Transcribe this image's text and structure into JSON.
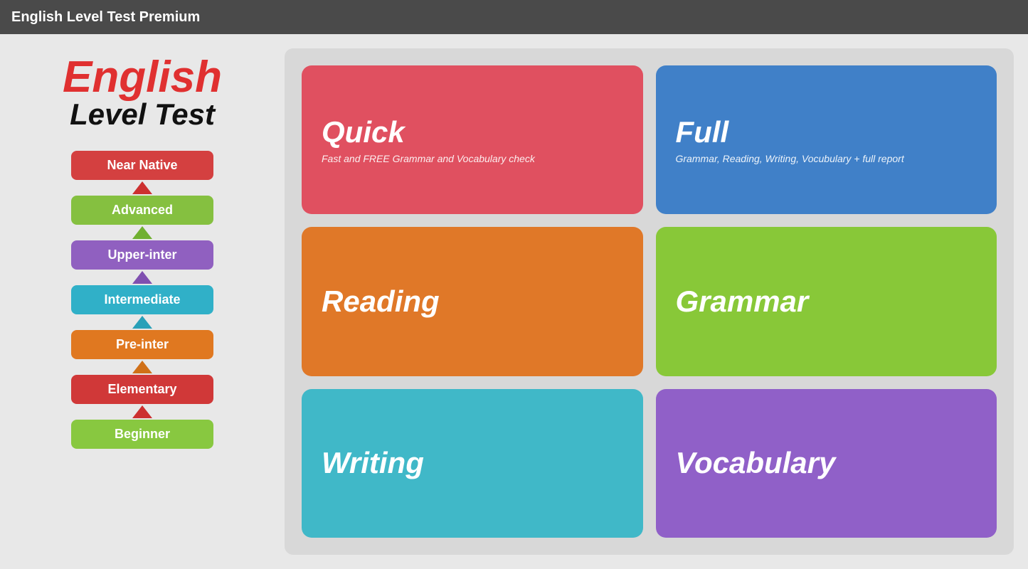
{
  "titleBar": {
    "label": "English Level Test Premium"
  },
  "logo": {
    "english": "English",
    "levelTest": "Level Test"
  },
  "levels": [
    {
      "id": "near-native",
      "label": "Near Native",
      "class": "level-near-native"
    },
    {
      "id": "advanced",
      "label": "Advanced",
      "class": "level-advanced"
    },
    {
      "id": "upper-inter",
      "label": "Upper-inter",
      "class": "level-upper-inter"
    },
    {
      "id": "intermediate",
      "label": "Intermediate",
      "class": "level-intermediate"
    },
    {
      "id": "pre-inter",
      "label": "Pre-inter",
      "class": "level-pre-inter"
    },
    {
      "id": "elementary",
      "label": "Elementary",
      "class": "level-elementary"
    },
    {
      "id": "beginner",
      "label": "Beginner",
      "class": "level-beginner"
    }
  ],
  "cards": [
    {
      "id": "quick",
      "title": "Quick",
      "subtitle": "Fast and FREE Grammar and Vocabulary check",
      "class": "card-quick"
    },
    {
      "id": "full",
      "title": "Full",
      "subtitle": "Grammar, Reading, Writing, Vocubulary + full report",
      "class": "card-full"
    },
    {
      "id": "reading",
      "title": "Reading",
      "subtitle": "",
      "class": "card-reading"
    },
    {
      "id": "grammar",
      "title": "Grammar",
      "subtitle": "",
      "class": "card-grammar"
    },
    {
      "id": "writing",
      "title": "Writing",
      "subtitle": "",
      "class": "card-writing"
    },
    {
      "id": "vocabulary",
      "title": "Vocabulary",
      "subtitle": "",
      "class": "card-vocabulary"
    }
  ],
  "arrows": [
    {
      "color": "arrow-red"
    },
    {
      "color": "arrow-green"
    },
    {
      "color": "arrow-purple"
    },
    {
      "color": "arrow-cyan"
    },
    {
      "color": "arrow-orange"
    },
    {
      "color": "arrow-red2"
    }
  ]
}
